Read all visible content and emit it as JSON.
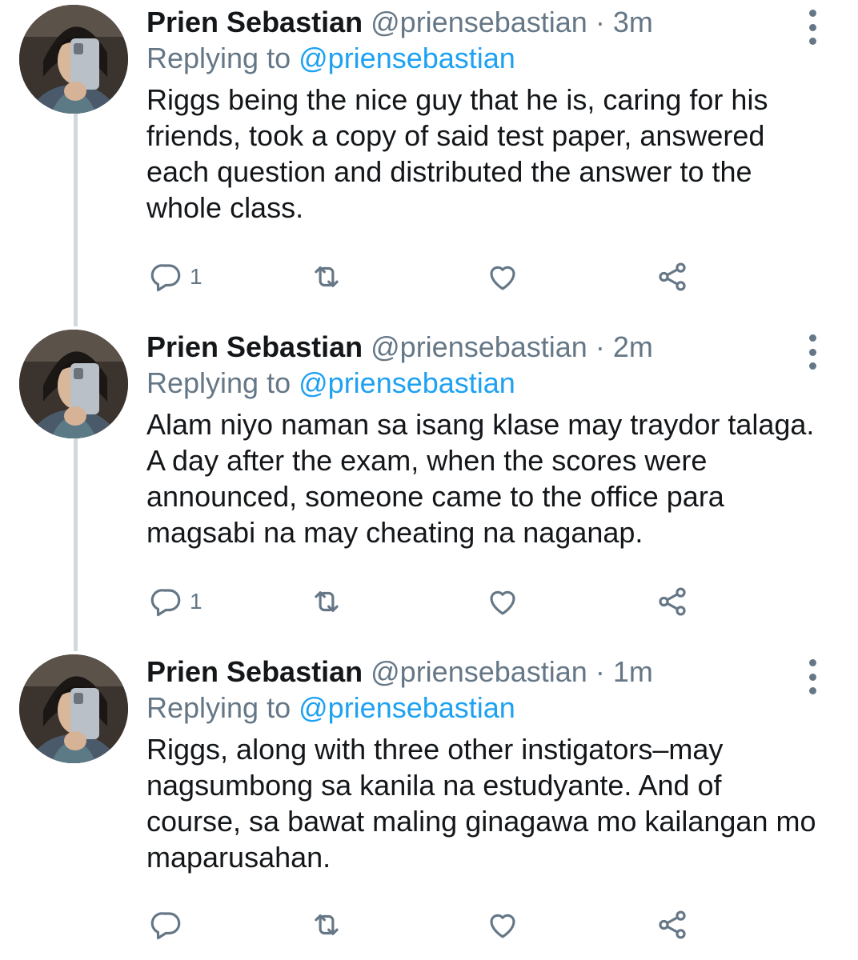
{
  "tweets": [
    {
      "name": "Prien Sebastian",
      "handle": "@priensebastian",
      "separator": "·",
      "time": "3m",
      "replying_prefix": "Replying to",
      "replying_to": "@priensebastian",
      "text": "Riggs being the nice guy that he is, caring for his friends, took a copy of said test paper, answered each question and distributed the answer to the whole class.",
      "reply_count": "1"
    },
    {
      "name": "Prien Sebastian",
      "handle": "@priensebastian",
      "separator": "·",
      "time": "2m",
      "replying_prefix": "Replying to",
      "replying_to": "@priensebastian",
      "text": "Alam niyo naman sa isang klase may traydor talaga. A day after the exam, when the scores were announced, someone came to the office para magsabi na may cheating na naganap.",
      "reply_count": "1"
    },
    {
      "name": "Prien Sebastian",
      "handle": "@priensebastian",
      "separator": "·",
      "time": "1m",
      "replying_prefix": "Replying to",
      "replying_to": "@priensebastian",
      "text": "Riggs, along with three other instigators–may nagsumbong sa kanila na estudyante. And of course, sa bawat maling ginagawa mo kailangan mo maparusahan.",
      "reply_count": ""
    }
  ],
  "icons": {
    "reply": "reply-icon",
    "retweet": "retweet-icon",
    "like": "heart-icon",
    "share": "share-icon",
    "more": "more-vertical-icon"
  },
  "colors": {
    "text": "#14171a",
    "secondary": "#657786",
    "link": "#1da1f2",
    "thread_line": "#cfd9de"
  }
}
